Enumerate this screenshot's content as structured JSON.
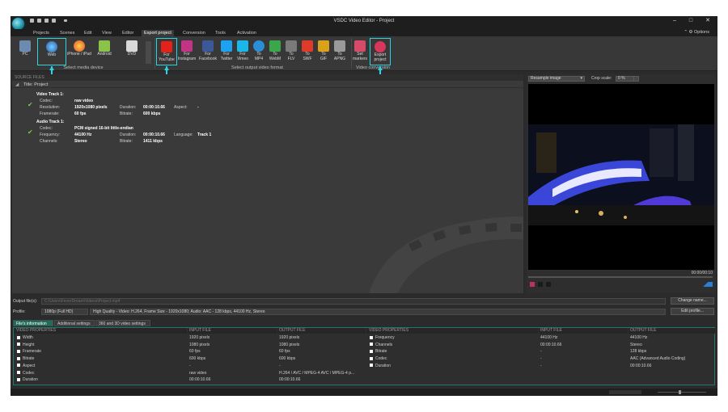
{
  "app": {
    "title": "VSDC Video Editor - Project",
    "options_label": "Options"
  },
  "menu": {
    "items": [
      "Projects",
      "Scenes",
      "Edit",
      "View",
      "Editor",
      "Export project",
      "Conversion",
      "Tools",
      "Activation"
    ],
    "active_index": 5
  },
  "ribbon": {
    "media_devices": [
      {
        "label": "PC",
        "icon": "pc-icon"
      },
      {
        "label": "Web",
        "icon": "globe-icon"
      },
      {
        "label": "iPhone / iPad",
        "icon": "apple-icon"
      },
      {
        "label": "Android",
        "icon": "android-icon"
      },
      {
        "label": "DVD",
        "icon": "dvd-icon"
      }
    ],
    "media_devices_group": "Select media device",
    "formats": [
      {
        "label": "For\nYouTube",
        "icon": "youtube-icon",
        "color": "#e62117"
      },
      {
        "label": "For\nInstagram",
        "icon": "instagram-icon",
        "color": "#c13584"
      },
      {
        "label": "For\nFacebook",
        "icon": "facebook-icon",
        "color": "#3b5998"
      },
      {
        "label": "For\nTwitter",
        "icon": "twitter-icon",
        "color": "#1da1f2"
      },
      {
        "label": "For\nVimeo",
        "icon": "vimeo-icon",
        "color": "#1ab7ea"
      },
      {
        "label": "To\nMP4",
        "icon": "mp4-icon",
        "color": "#2a8fd6"
      },
      {
        "label": "To\nWebM",
        "icon": "webm-icon",
        "color": "#3aa84a"
      },
      {
        "label": "To\nFLV",
        "icon": "flv-icon",
        "color": "#7a7a7a"
      },
      {
        "label": "To\nSWF",
        "icon": "swf-icon",
        "color": "#e03a2a"
      },
      {
        "label": "To\nGIF",
        "icon": "gif-icon",
        "color": "#d9a21a"
      },
      {
        "label": "To\nAPNG",
        "icon": "apng-icon",
        "color": "#9a9a9a"
      }
    ],
    "formats_group": "Select output video format",
    "conversion": [
      {
        "label": "Set\nmarkers",
        "icon": "marker-flag-icon"
      },
      {
        "label": "Export\nproject",
        "icon": "export-icon"
      }
    ],
    "conversion_group": "Video conversion"
  },
  "source_files": {
    "header": "SOURCE FILES",
    "project": "Title: Project",
    "video_track": {
      "title": "Video Track 1:",
      "codec_label": "Codec:",
      "codec": "raw video",
      "resolution_label": "Resolution:",
      "resolution": "1920x1080 pixels",
      "duration_label": "Duration:",
      "duration": "00:00:10.66",
      "aspect_label": "Aspect:",
      "aspect": "-",
      "framerate_label": "Framerate:",
      "framerate": "60 fps",
      "bitrate_label": "Bitrate:",
      "bitrate": "600 kbps"
    },
    "audio_track": {
      "title": "Audio Track 1:",
      "codec_label": "Codec:",
      "codec": "PCM signed 16-bit little-endian",
      "frequency_label": "Frequency:",
      "frequency": "44100 Hz",
      "duration_label": "Duration:",
      "duration": "00:00:10.66",
      "language_label": "Language:",
      "language": "Track 1",
      "channels_label": "Channels:",
      "channels": "Stereo",
      "bitrate_label": "Bitrate:",
      "bitrate": "1411 kbps"
    }
  },
  "preview": {
    "mode": "Resample image",
    "crop_label": "Crop scale:",
    "crop_value": "0 %",
    "time": "00:00/00:10"
  },
  "output": {
    "file_label": "Output file(s):",
    "file_value": "C:\\Users\\FeverDream\\Videos\\Project.mp4",
    "change_name": "Change name...",
    "profile_label": "Profile:",
    "profile_value": "1080p (Full HD)",
    "profile_desc": "High Quality - Video: H.264, Frame Size - 1920x1080; Audio: AAC - 128 kbps, 44100 Hz, Stereo",
    "edit_profile": "Edit profile..."
  },
  "tabs": [
    "File's information",
    "Additional settings",
    "360 and 3D video settings"
  ],
  "video_props": {
    "headers": [
      "VIDEO PROPERTIES",
      "INPUT FILE",
      "OUTPUT FILE"
    ],
    "rows": [
      [
        "Width",
        "1920 pixels",
        "1920 pixels"
      ],
      [
        "Height",
        "1080 pixels",
        "1080 pixels"
      ],
      [
        "Framerate",
        "60 fps",
        "60 fps"
      ],
      [
        "Bitrate",
        "600 kbps",
        "600 kbps"
      ],
      [
        "Aspect",
        "-",
        "-"
      ],
      [
        "Codec",
        "raw video",
        "H.264 / AVC / MPEG-4 AVC / MPEG-4 p..."
      ],
      [
        "Duration",
        "00:00:10.66",
        "00:00:10.66"
      ]
    ]
  },
  "audio_props": {
    "headers": [
      "VIDEO PROPERTIES",
      "INPUT FILE",
      "OUTPUT FILE"
    ],
    "rows": [
      [
        "Frequency",
        "44100 Hz",
        "44100 Hz"
      ],
      [
        "Channels",
        "00:00:10.66",
        "Stereo"
      ],
      [
        "Bitrate",
        "-",
        "128 kbps"
      ],
      [
        "Codec",
        "-",
        "AAC (Advanced Audio Coding)"
      ],
      [
        "Duration",
        "-",
        "00:00:10.66"
      ]
    ]
  }
}
